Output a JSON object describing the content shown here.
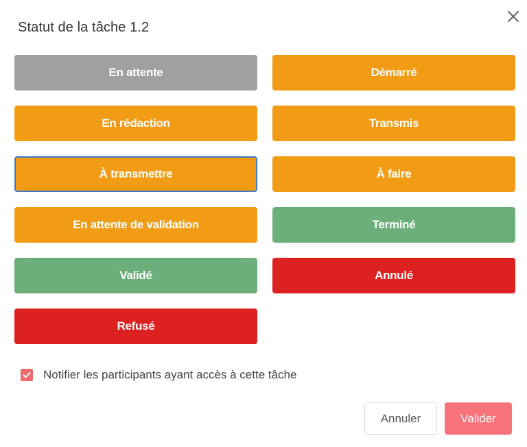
{
  "dialog": {
    "title": "Statut de la tâche 1.2",
    "close_icon": "close-icon"
  },
  "colors": {
    "gray": "#a0a0a0",
    "orange": "#f29c16",
    "green": "#6daf7b",
    "red": "#dd2020",
    "focus_border": "#3a7ac4",
    "primary": "#f7737a"
  },
  "statuses": [
    {
      "label": "En attente",
      "color": "gray"
    },
    {
      "label": "Démarré",
      "color": "orange"
    },
    {
      "label": "En rédaction",
      "color": "orange"
    },
    {
      "label": "Transmis",
      "color": "orange"
    },
    {
      "label": "À transmettre",
      "color": "orange",
      "focused": true
    },
    {
      "label": "À faire",
      "color": "orange"
    },
    {
      "label": "En attente de validation",
      "color": "orange"
    },
    {
      "label": "Terminé",
      "color": "green"
    },
    {
      "label": "Validé",
      "color": "green"
    },
    {
      "label": "Annulé",
      "color": "red"
    },
    {
      "label": "Refusé",
      "color": "red"
    }
  ],
  "notify": {
    "label": "Notifier les participants ayant accès à cette tâche",
    "checked": true
  },
  "footer": {
    "cancel_label": "Annuler",
    "validate_label": "Valider"
  }
}
